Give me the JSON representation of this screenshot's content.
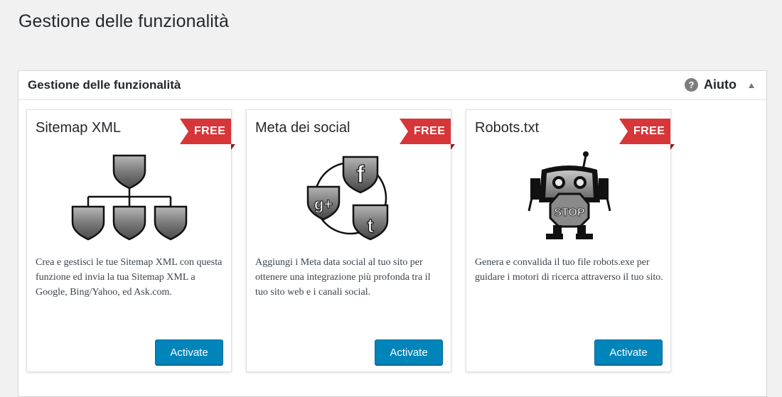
{
  "page": {
    "title": "Gestione delle funzionalità"
  },
  "panel": {
    "title": "Gestione delle funzionalità",
    "help_label": "Aiuto",
    "help_icon": "question-mark-icon",
    "toggle_icon": "collapse-arrow-icon"
  },
  "colors": {
    "ribbon": "#d63638",
    "button": "#0085ba",
    "background": "#f1f1f1"
  },
  "cards": [
    {
      "title": "Sitemap XML",
      "badge": "FREE",
      "icon": "sitemap-tree-icon",
      "description": "Crea e gestisci le tue Sitemap XML con questa funzione ed invia la tua Sitemap XML a Google, Bing/Yahoo, ed Ask.com.",
      "button": "Activate"
    },
    {
      "title": "Meta dei social",
      "badge": "FREE",
      "icon": "social-network-icon",
      "description": "Aggiungi i Meta data social al tuo sito per ottenere una integrazione più profonda tra il tuo sito web e i canali social.",
      "button": "Activate"
    },
    {
      "title": "Robots.txt",
      "badge": "FREE",
      "icon": "robot-stop-icon",
      "description": "Genera e convalida il tuo file robots.exe per guidare i motori di ricerca attraverso il tuo sito.",
      "button": "Activate"
    }
  ]
}
